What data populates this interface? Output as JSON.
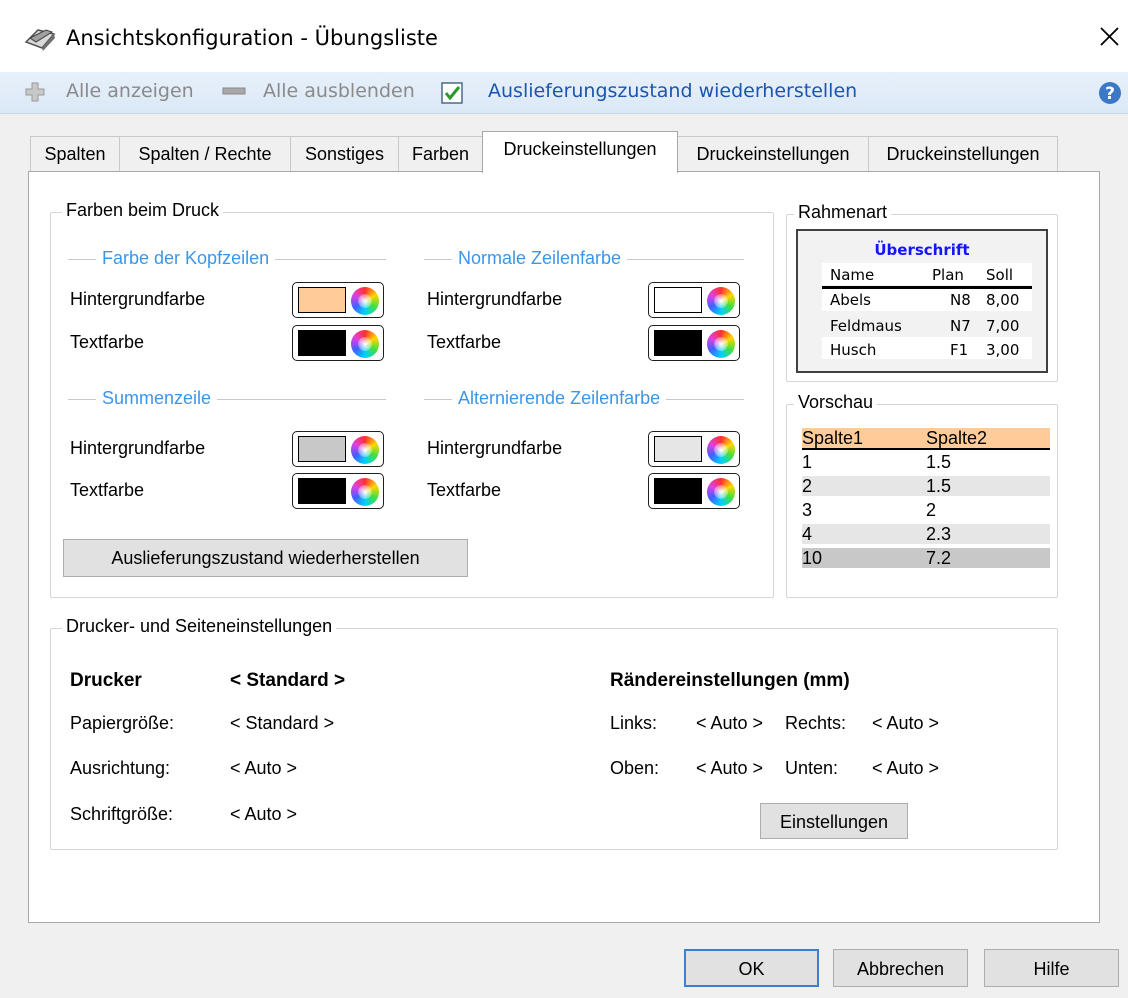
{
  "window": {
    "title": "Ansichtskonfiguration - Übungsliste"
  },
  "toolbar": {
    "show_all": "Alle anzeigen",
    "hide_all": "Alle ausblenden",
    "restore": "Auslieferungszustand wiederherstellen"
  },
  "tabs": [
    {
      "label": "Spalten"
    },
    {
      "label": "Spalten / Rechte"
    },
    {
      "label": "Sonstiges"
    },
    {
      "label": "Farben"
    },
    {
      "label": "Druckeinstellungen"
    },
    {
      "label": "Druckeinstellungen"
    },
    {
      "label": "Druckeinstellungen"
    }
  ],
  "print_colors": {
    "legend": "Farben beim Druck",
    "header_rows": {
      "title": "Farbe der Kopfzeilen",
      "bg_label": "Hintergrundfarbe",
      "bg_color": "#ffcc99",
      "text_label": "Textfarbe",
      "text_color": "#000000"
    },
    "normal_rows": {
      "title": "Normale Zeilenfarbe",
      "bg_label": "Hintergrundfarbe",
      "bg_color": "#ffffff",
      "text_label": "Textfarbe",
      "text_color": "#000000"
    },
    "sum_row": {
      "title": "Summenzeile",
      "bg_label": "Hintergrundfarbe",
      "bg_color": "#c8c8c8",
      "text_label": "Textfarbe",
      "text_color": "#000000"
    },
    "alt_rows": {
      "title": "Alternierende Zeilenfarbe",
      "bg_label": "Hintergrundfarbe",
      "bg_color": "#e6e6e6",
      "text_label": "Textfarbe",
      "text_color": "#000000"
    },
    "restore_button": "Auslieferungszustand wiederherstellen"
  },
  "frame_type": {
    "legend": "Rahmenart",
    "heading": "Überschrift",
    "columns": [
      "Name",
      "Plan",
      "Soll"
    ],
    "rows": [
      [
        "Abels",
        "N8",
        "8,00"
      ],
      [
        "Feldmaus",
        "N7",
        "7,00"
      ],
      [
        "Husch",
        "F1",
        "3,00"
      ]
    ]
  },
  "preview": {
    "legend": "Vorschau",
    "columns": [
      "Spalte1",
      "Spalte2"
    ],
    "rows": [
      [
        "1",
        "1.5"
      ],
      [
        "2",
        "1.5"
      ],
      [
        "3",
        "2"
      ],
      [
        "4",
        "2.3"
      ],
      [
        "10",
        "7.2"
      ]
    ]
  },
  "printer": {
    "legend": "Drucker- und Seiteneinstellungen",
    "printer_label": "Drucker",
    "printer_value": "< Standard >",
    "paper_label": "Papiergröße:",
    "paper_value": "< Standard >",
    "orientation_label": "Ausrichtung:",
    "orientation_value": "< Auto >",
    "font_size_label": "Schriftgröße:",
    "font_size_value": "< Auto >",
    "margins_heading": "Rändereinstellungen (mm)",
    "left_label": "Links:",
    "left_value": "< Auto >",
    "right_label": "Rechts:",
    "right_value": "< Auto >",
    "top_label": "Oben:",
    "top_value": "< Auto >",
    "bottom_label": "Unten:",
    "bottom_value": "< Auto >",
    "settings_button": "Einstellungen"
  },
  "dialog_buttons": {
    "ok": "OK",
    "cancel": "Abbrechen",
    "help": "Hilfe"
  }
}
